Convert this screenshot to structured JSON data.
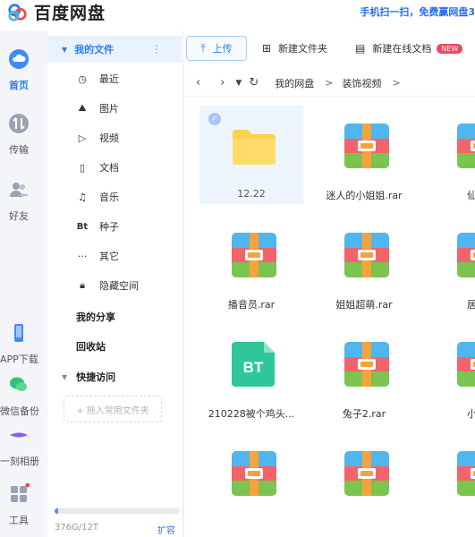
{
  "app": {
    "title": "百度网盘",
    "promo": "手机扫一扫，免费赢网盘3"
  },
  "leftnav": {
    "items": [
      {
        "label": "首页",
        "icon": "cloud-icon",
        "active": true
      },
      {
        "label": "传输",
        "icon": "transfer-icon"
      },
      {
        "label": "好友",
        "icon": "friends-icon"
      },
      {
        "label": "APP下载",
        "icon": "phone-icon"
      },
      {
        "label": "微信备份",
        "icon": "wechat-icon"
      },
      {
        "label": "一刻相册",
        "icon": "album-icon"
      },
      {
        "label": "工具",
        "icon": "tools-icon"
      }
    ]
  },
  "sidebar": {
    "my_files": "我的文件",
    "items": [
      {
        "label": "最近",
        "icon": "clock-icon"
      },
      {
        "label": "图片",
        "icon": "mountain-icon"
      },
      {
        "label": "视频",
        "icon": "play-icon"
      },
      {
        "label": "文档",
        "icon": "doc-icon"
      },
      {
        "label": "音乐",
        "icon": "headphone-icon"
      },
      {
        "label": "种子",
        "icon": "bt-icon",
        "glyph": "Bt"
      },
      {
        "label": "其它",
        "icon": "dots-icon"
      },
      {
        "label": "隐藏空间",
        "icon": "lock-icon"
      }
    ],
    "my_share": "我的分享",
    "recycle": "回收站",
    "quick_access": "快捷访问",
    "drop_hint": "+ 拖入常用文件夹",
    "storage_text": "376G/12T",
    "storage_fraction": 0.031,
    "expand_label": "扩容"
  },
  "toolbar": {
    "upload": "上传",
    "new_folder": "新建文件夹",
    "new_online_doc": "新建在线文档",
    "new_badge": "NEW"
  },
  "path": {
    "crumbs": [
      "我的网盘",
      "装饰视频"
    ],
    "separator": ">"
  },
  "files": [
    {
      "name": "12.22",
      "type": "folder",
      "selected": true
    },
    {
      "name": "迷人的小姐姐.rar",
      "type": "rar"
    },
    {
      "name": "仙女",
      "type": "rar"
    },
    {
      "name": "播音员.rar",
      "type": "rar"
    },
    {
      "name": "姐姐超萌.rar",
      "type": "rar"
    },
    {
      "name": "居家",
      "type": "rar"
    },
    {
      "name": "210228被个鸡头...",
      "type": "bt",
      "badge": "BT"
    },
    {
      "name": "兔子2.rar",
      "type": "rar"
    },
    {
      "name": "小王",
      "type": "rar"
    },
    {
      "name": "",
      "type": "rar"
    },
    {
      "name": "",
      "type": "rar"
    },
    {
      "name": "",
      "type": "rar"
    }
  ],
  "colors": {
    "accent": "#2a7cf6",
    "folder": "#ffd04a",
    "bt": "#2fc79a",
    "rar_blue": "#4fb6ef",
    "rar_red": "#f2646a",
    "rar_green": "#7bc44f",
    "rar_orange": "#f9a13a"
  }
}
